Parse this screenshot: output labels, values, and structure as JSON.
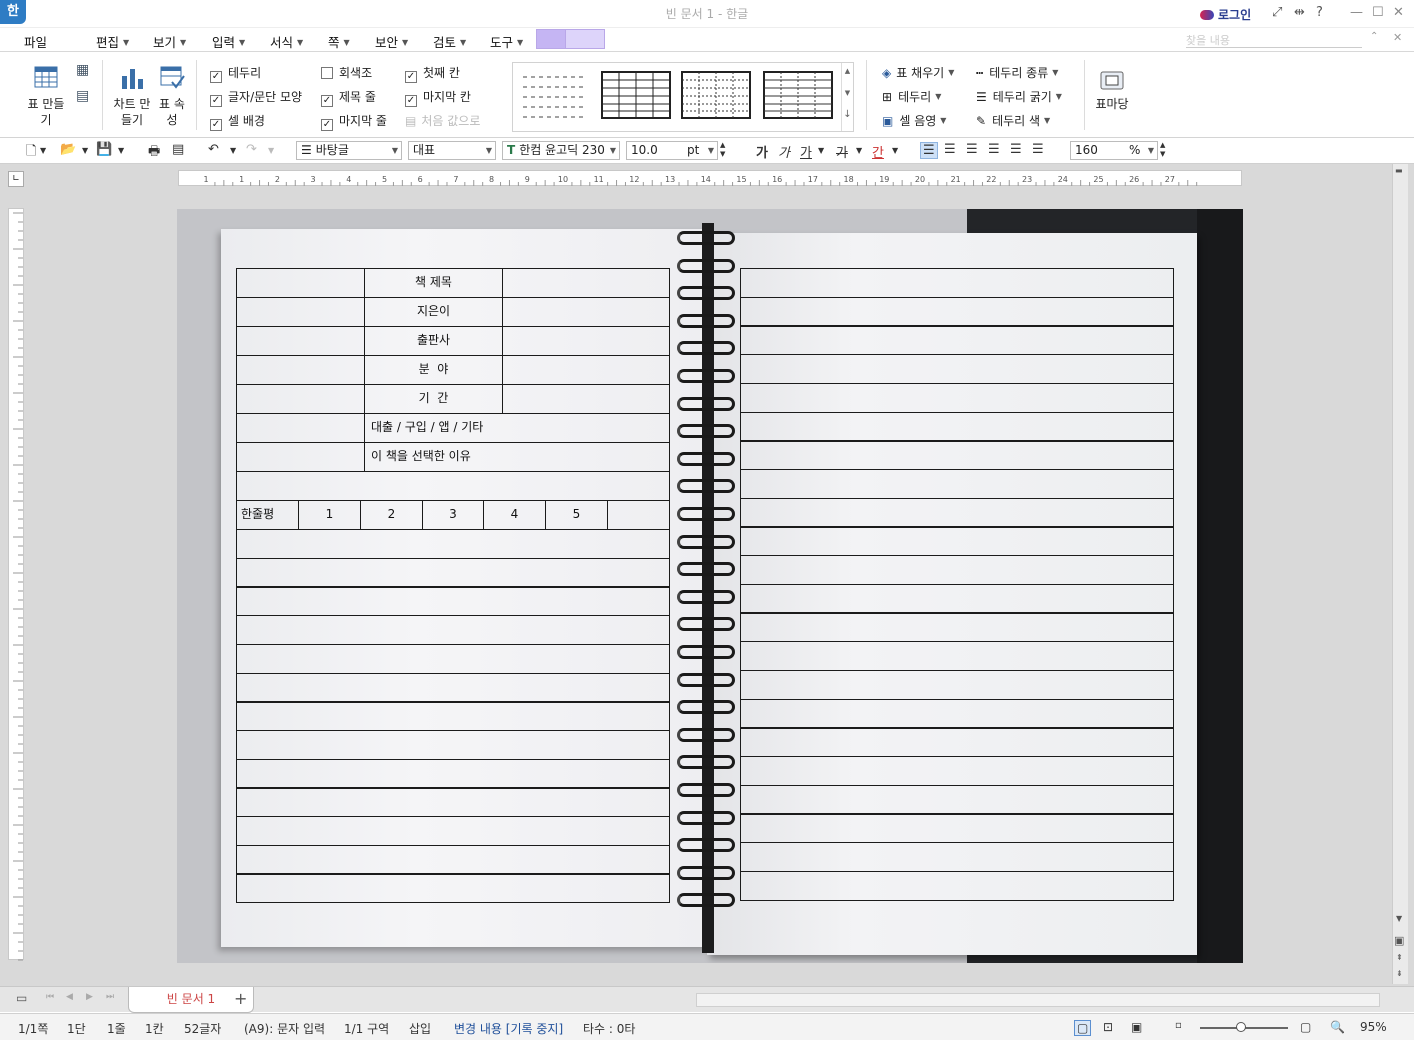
{
  "window": {
    "title": "빈 문서 1 - 한글",
    "logo": "한",
    "login": "로그인"
  },
  "menu": [
    "파일",
    "편집",
    "보기",
    "입력",
    "서식",
    "쪽",
    "보안",
    "검토",
    "도구"
  ],
  "search_placeholder": "찾을 내용",
  "ribbon": {
    "table_make": "표 만들기",
    "chart_make": "차트 만들기",
    "table_props": "표 속성",
    "checks_col1": [
      {
        "label": "테두리",
        "checked": true
      },
      {
        "label": "글자/문단 모양",
        "checked": true
      },
      {
        "label": "셀 배경",
        "checked": true
      }
    ],
    "checks_col2": [
      {
        "label": "회색조",
        "checked": false
      },
      {
        "label": "제목 줄",
        "checked": true
      },
      {
        "label": "마지막 줄",
        "checked": true
      }
    ],
    "checks_col3": [
      {
        "label": "첫째 칸",
        "checked": true
      },
      {
        "label": "마지막 칸",
        "checked": true
      }
    ],
    "reset": "처음 값으로",
    "right_col1": [
      "표 채우기",
      "테두리",
      "셀 음영"
    ],
    "right_col2": [
      "테두리 종류",
      "테두리 굵기",
      "테두리 색"
    ],
    "table_field": "표마당"
  },
  "toolbar": {
    "style": "바탕글",
    "font_lang": "대표",
    "font": "한컴 윤고딕 230",
    "size": "10.0",
    "unit": "pt",
    "line_spacing": "160",
    "line_unit": "%",
    "bold": "가",
    "italic": "가",
    "underline": "가",
    "strike": "가",
    "shade": "간"
  },
  "ruler_h": [
    "1",
    "1",
    "2",
    "3",
    "4",
    "5",
    "6",
    "7",
    "8",
    "9",
    "10",
    "11",
    "12",
    "13",
    "14",
    "15",
    "16",
    "17",
    "18",
    "19",
    "20",
    "21",
    "22",
    "23",
    "24",
    "25",
    "26",
    "27"
  ],
  "form": {
    "book_title": "책 제목",
    "author": "지은이",
    "publisher": "출판사",
    "genre": "분  야",
    "period": "기  간",
    "method": "대출 / 구입 / 앱 / 기타",
    "reason": "이 책을 선택한 이유",
    "oneline": "한줄평",
    "ratings": [
      "1",
      "2",
      "3",
      "4",
      "5"
    ]
  },
  "tabs": {
    "doc": "빈 문서 1",
    "add": "+"
  },
  "status": [
    "1/1쪽",
    "1단",
    "1줄",
    "1칸",
    "52글자",
    "(A9): 문자 입력",
    "1/1 구역",
    "삽입",
    "변경 내용 [기록 중지]",
    "타수 : 0타"
  ],
  "zoom": "95%"
}
